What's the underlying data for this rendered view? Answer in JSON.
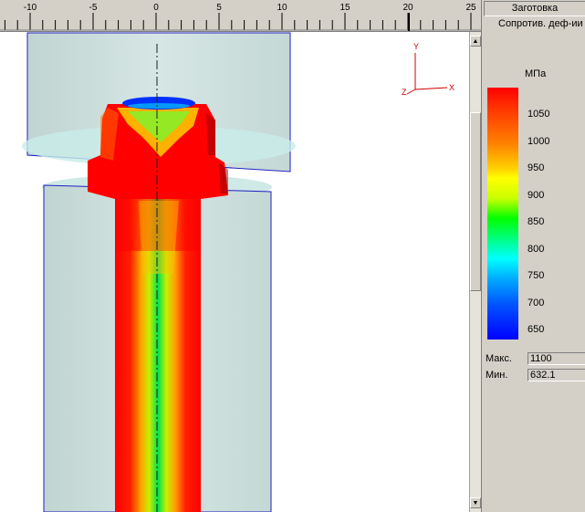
{
  "ruler": {
    "ticks": [
      "-10",
      "-5",
      "0",
      "5",
      "10",
      "15",
      "20",
      "25"
    ]
  },
  "axes": {
    "y": "Y",
    "x": "X",
    "z": "Z"
  },
  "panel": {
    "tab": "Заготовка",
    "subtitle": "Сопротив. деф-ии",
    "units": "МПа",
    "scale": [
      "1050",
      "1000",
      "950",
      "900",
      "850",
      "800",
      "750",
      "700",
      "650"
    ],
    "max_label": "Макс.",
    "max_value": "1100",
    "min_label": "Мин.",
    "min_value": "632.1"
  },
  "colors": {
    "high": "#ff0000",
    "mid": "#ffff00",
    "low": "#0000ff",
    "die": "#c8dcd8",
    "outline": "#2020c0"
  },
  "scrollbar": {
    "up": "▲",
    "down": "▼"
  }
}
